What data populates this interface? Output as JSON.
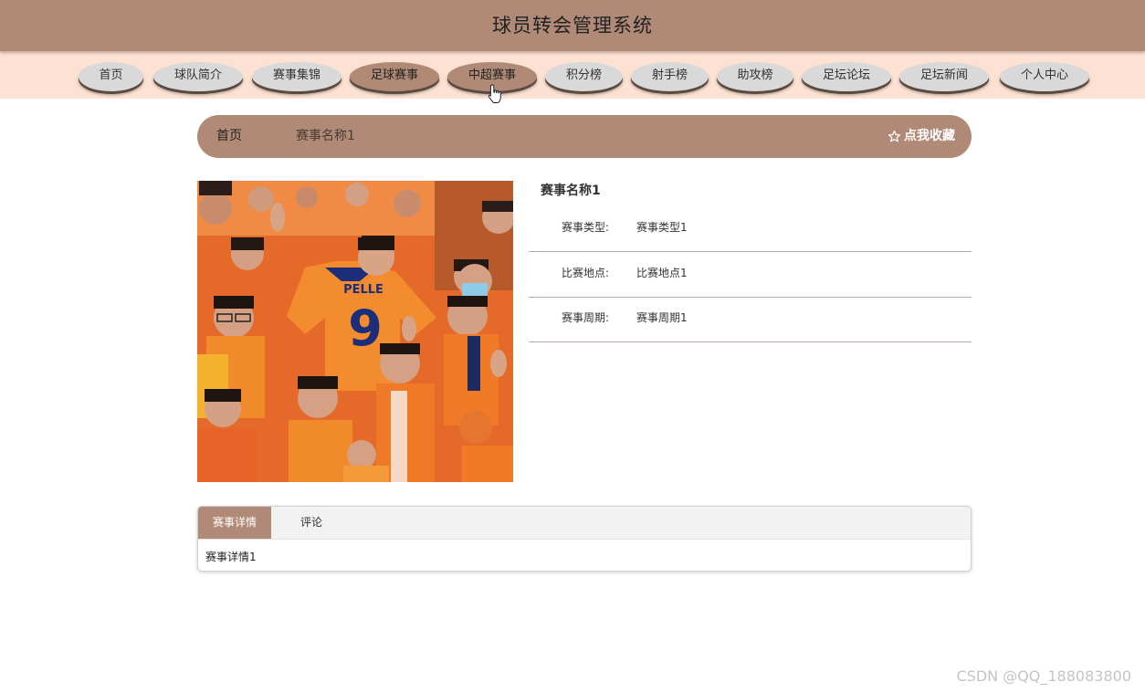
{
  "header": {
    "title": "球员转会管理系统"
  },
  "nav": {
    "items": [
      {
        "label": "首页"
      },
      {
        "label": "球队简介"
      },
      {
        "label": "赛事集锦"
      },
      {
        "label": "足球赛事"
      },
      {
        "label": "中超赛事"
      },
      {
        "label": "积分榜"
      },
      {
        "label": "射手榜"
      },
      {
        "label": "助攻榜"
      },
      {
        "label": "足坛论坛"
      },
      {
        "label": "足坛新闻"
      },
      {
        "label": "个人中心"
      }
    ],
    "active_index": 3,
    "hover_index": 4
  },
  "breadcrumb": {
    "home": "首页",
    "current": "赛事名称1",
    "favorite_label": "点我收藏"
  },
  "photo": {
    "jersey_name": "PELLE",
    "jersey_number": "9"
  },
  "detail": {
    "title": "赛事名称1",
    "fields": [
      {
        "label": "赛事类型:",
        "value": "赛事类型1"
      },
      {
        "label": "比赛地点:",
        "value": "比赛地点1"
      },
      {
        "label": "赛事周期:",
        "value": "赛事周期1"
      }
    ]
  },
  "tabs": {
    "items": [
      {
        "label": "赛事详情"
      },
      {
        "label": "评论"
      }
    ],
    "content": "赛事详情1"
  },
  "watermark": "CSDN @QQ_188083800",
  "colors": {
    "primary": "#b08a76",
    "nav_bg": "#fde1d2",
    "nav_pill": "#d9d9d9"
  }
}
